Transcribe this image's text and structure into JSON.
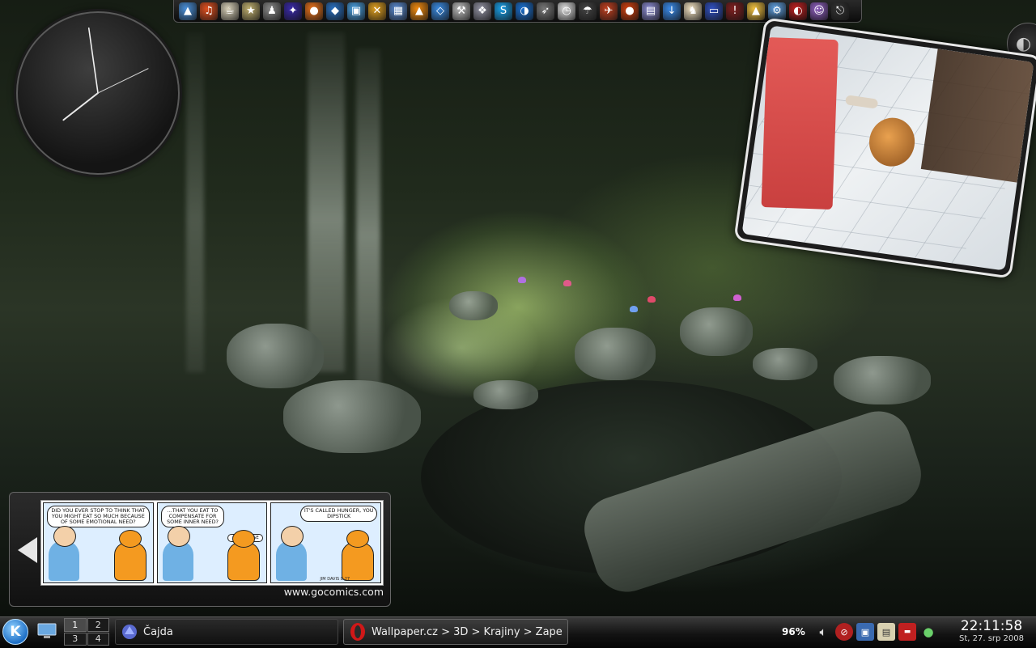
{
  "launcher": {
    "icons": [
      {
        "name": "arch-icon",
        "color": "#4a8fd8",
        "glyph": "▲"
      },
      {
        "name": "audio-player-icon",
        "color": "#e05020",
        "glyph": "♫"
      },
      {
        "name": "java-icon",
        "color": "#d8d0b8",
        "glyph": "☕"
      },
      {
        "name": "stellarium-icon",
        "color": "#c0b070",
        "glyph": "★"
      },
      {
        "name": "game-figure-icon",
        "color": "#888888",
        "glyph": "♟"
      },
      {
        "name": "space-icon",
        "color": "#3a2aa8",
        "glyph": "✦"
      },
      {
        "name": "firefox-icon",
        "color": "#e8721c",
        "glyph": "●"
      },
      {
        "name": "globe-icon",
        "color": "#2a70c0",
        "glyph": "◆"
      },
      {
        "name": "document-icon",
        "color": "#4aa0e0",
        "glyph": "▣"
      },
      {
        "name": "tools-icon",
        "color": "#e0a020",
        "glyph": "✕"
      },
      {
        "name": "grid-app-icon",
        "color": "#5a8ad0",
        "glyph": "▦"
      },
      {
        "name": "vlc-icon",
        "color": "#f08a10",
        "glyph": "▲"
      },
      {
        "name": "package-icon",
        "color": "#3a8ae0",
        "glyph": "◇"
      },
      {
        "name": "hammer-icon",
        "color": "#bbbbbb",
        "glyph": "⚒"
      },
      {
        "name": "gimp-icon",
        "color": "#9090a0",
        "glyph": "❖"
      },
      {
        "name": "skype-icon",
        "color": "#1aa0e8",
        "glyph": "S"
      },
      {
        "name": "browser-icon",
        "color": "#1a70d0",
        "glyph": "◑"
      },
      {
        "name": "gun-game-icon",
        "color": "#777777",
        "glyph": "➶"
      },
      {
        "name": "clock-app-icon",
        "color": "#dddddd",
        "glyph": "◷"
      },
      {
        "name": "umbrella-icon",
        "color": "#444444",
        "glyph": "☂"
      },
      {
        "name": "rocket-icon",
        "color": "#c04020",
        "glyph": "✈"
      },
      {
        "name": "red-circle-icon",
        "color": "#d04010",
        "glyph": "●"
      },
      {
        "name": "terminal-icon",
        "color": "#8a8ad0",
        "glyph": "▤"
      },
      {
        "name": "download-icon",
        "color": "#3a8ae8",
        "glyph": "↓"
      },
      {
        "name": "penguin-icon",
        "color": "#f0e0c0",
        "glyph": "♞"
      },
      {
        "name": "desktop-icon",
        "color": "#3050c0",
        "glyph": "▭"
      },
      {
        "name": "warning-app-icon",
        "color": "#802020",
        "glyph": "!"
      },
      {
        "name": "tux-icon",
        "color": "#f0c040",
        "glyph": "▲"
      },
      {
        "name": "wrench-icon",
        "color": "#60a0e0",
        "glyph": "⚙"
      },
      {
        "name": "red-shield-icon",
        "color": "#c02020",
        "glyph": "◐"
      },
      {
        "name": "purple-face-icon",
        "color": "#9060c0",
        "glyph": "☺"
      },
      {
        "name": "exit-icon",
        "color": "#333333",
        "glyph": "⎋"
      }
    ]
  },
  "clock": {
    "hour_angle": 232,
    "minute_angle": 352,
    "second_angle": 64
  },
  "comic": {
    "panel1": "DID YOU EVER STOP TO THINK THAT YOU MIGHT EAT SO MUCH BECAUSE OF SOME EMOTIONAL NEED?",
    "panel2": "...THAT YOU EAT TO COMPENSATE FOR SOME INNER NEED?",
    "panel2_garfield": "OF COURSE",
    "panel3": "IT'S CALLED HUNGER, YOU DIPSTICK",
    "signature": "JIM DAVIS 8-27",
    "source": "www.gocomics.com"
  },
  "taskbar": {
    "kmenu_label": "K",
    "pager": [
      "1",
      "2",
      "3",
      "4"
    ],
    "active_desktop": "1",
    "tasks": [
      {
        "label": "Čajda"
      },
      {
        "label": "Wallpaper.cz > 3D > Krajiny > Zape"
      }
    ],
    "battery": "96%",
    "time": "22:11:58",
    "date": "St, 27. srp 2008"
  }
}
